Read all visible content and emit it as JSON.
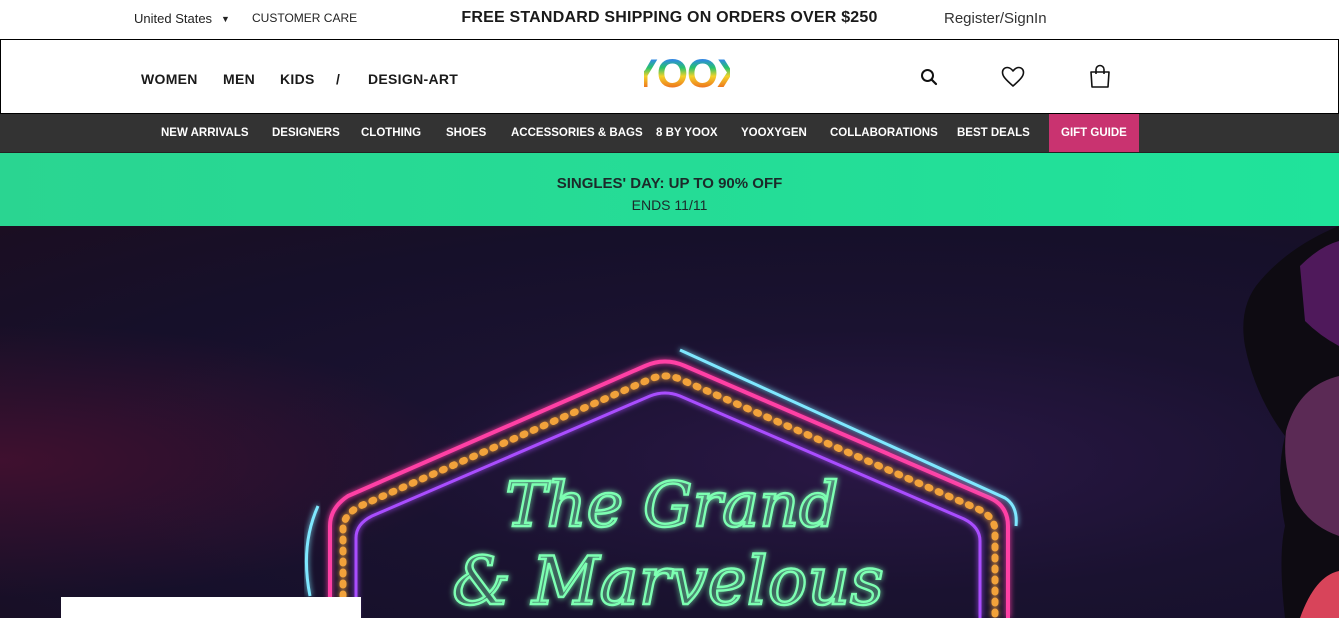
{
  "topbar": {
    "country": "United States",
    "customer_care": "CUSTOMER CARE",
    "shipping_banner": "FREE STANDARD SHIPPING ON ORDERS OVER $250",
    "register_signin": "Register/SignIn"
  },
  "header": {
    "nav": [
      "WOMEN",
      "MEN",
      "KIDS",
      "/",
      "DESIGN-ART"
    ],
    "logo_text": "YOOX",
    "icons": [
      "search-icon",
      "heart-icon",
      "shopping-bag-icon"
    ]
  },
  "categories": [
    "NEW ARRIVALS",
    "DESIGNERS",
    "CLOTHING",
    "SHOES",
    "ACCESSORIES & BAGS",
    "8 BY YOOX",
    "YOOXYGEN",
    "COLLABORATIONS",
    "BEST DEALS",
    "GIFT GUIDE"
  ],
  "promo": {
    "title": "SINGLES' DAY: UP TO 90% OFF",
    "subtitle": "ENDS 11/11"
  },
  "hero": {
    "sign_line1": "The Grand",
    "sign_line2": "& Marvelous"
  },
  "colors": {
    "category_bar": "#333333",
    "gift_guide": "#c93370",
    "promo": "#22dd96",
    "neon_pink": "#ff3fa5",
    "neon_green": "#7dffb2",
    "neon_cyan": "#7fe8ff"
  }
}
